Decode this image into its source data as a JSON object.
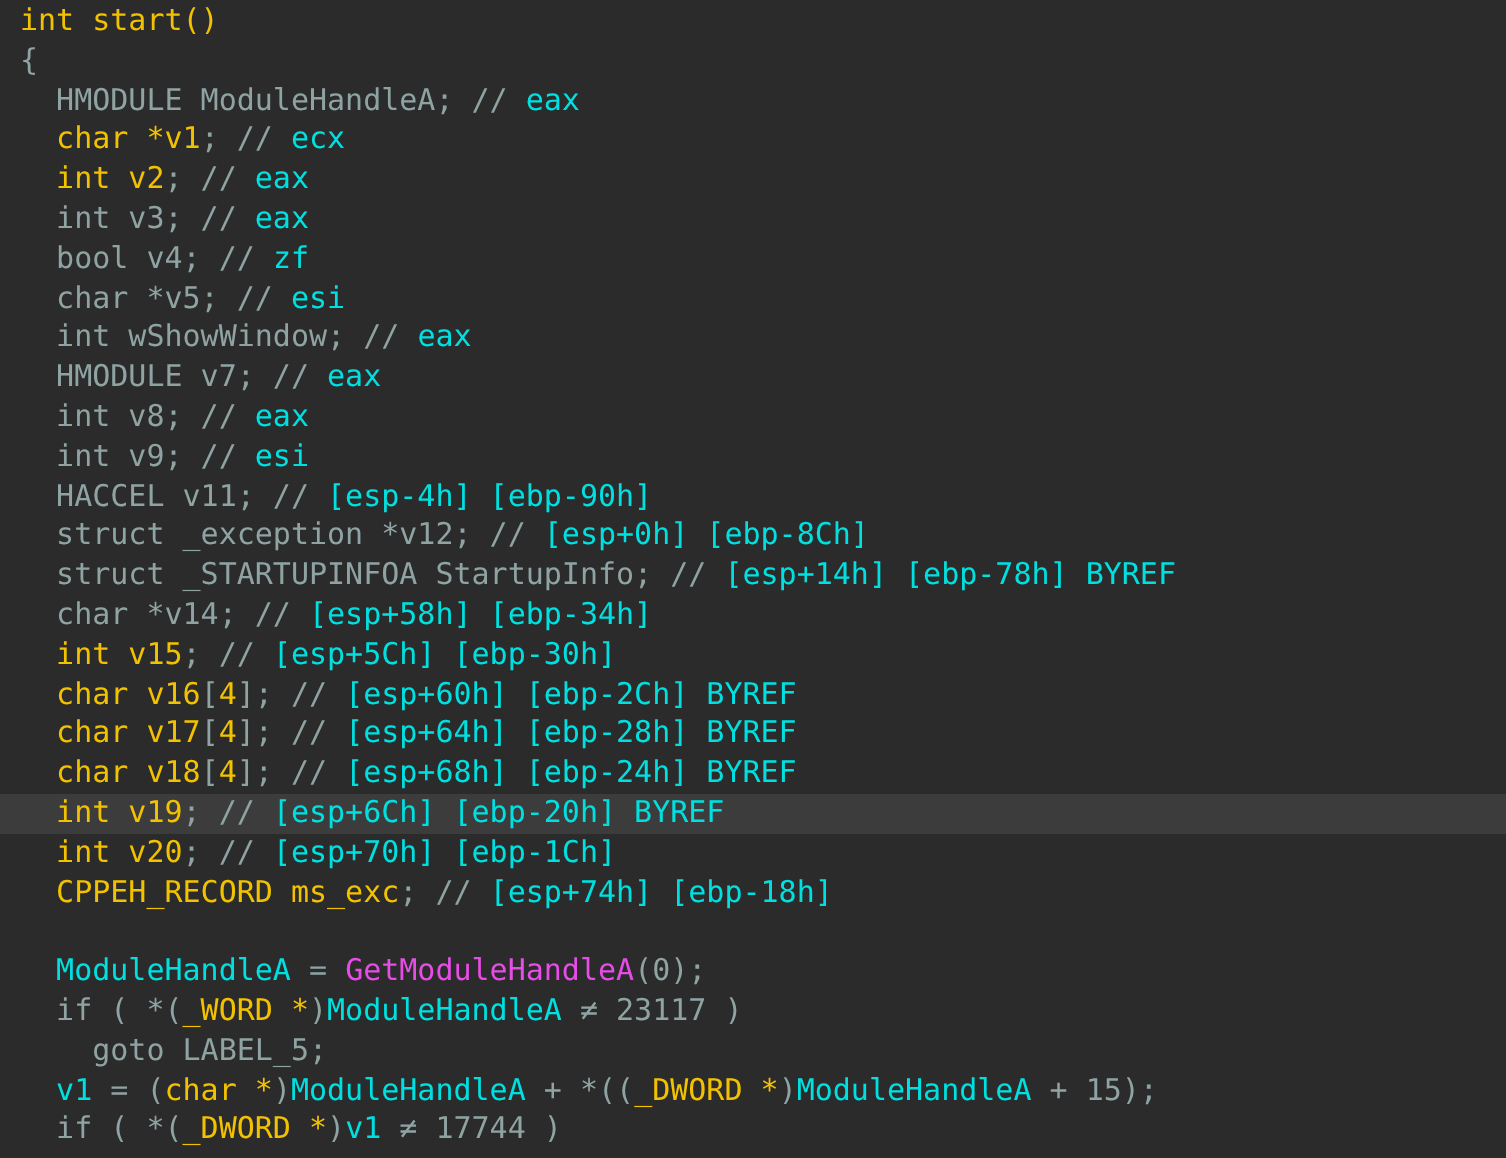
{
  "editor": {
    "lines": [
      {
        "current": false,
        "tokens": [
          {
            "kind": "var",
            "text": "int start()"
          }
        ]
      },
      {
        "current": false,
        "tokens": [
          {
            "kind": "plain",
            "text": "{"
          }
        ]
      },
      {
        "current": false,
        "tokens": [
          {
            "kind": "plain",
            "text": "  HMODULE ModuleHandleA; // "
          },
          {
            "kind": "ident",
            "text": "eax"
          }
        ]
      },
      {
        "current": false,
        "tokens": [
          {
            "kind": "var",
            "text": "  char *v1"
          },
          {
            "kind": "plain",
            "text": "; // "
          },
          {
            "kind": "ident",
            "text": "ecx"
          }
        ]
      },
      {
        "current": false,
        "tokens": [
          {
            "kind": "var",
            "text": "  int v2"
          },
          {
            "kind": "plain",
            "text": "; // "
          },
          {
            "kind": "ident",
            "text": "eax"
          }
        ]
      },
      {
        "current": false,
        "tokens": [
          {
            "kind": "plain",
            "text": "  int v3; // "
          },
          {
            "kind": "ident",
            "text": "eax"
          }
        ]
      },
      {
        "current": false,
        "tokens": [
          {
            "kind": "plain",
            "text": "  bool v4; // "
          },
          {
            "kind": "ident",
            "text": "zf"
          }
        ]
      },
      {
        "current": false,
        "tokens": [
          {
            "kind": "plain",
            "text": "  char *v5; // "
          },
          {
            "kind": "ident",
            "text": "esi"
          }
        ]
      },
      {
        "current": false,
        "tokens": [
          {
            "kind": "plain",
            "text": "  int wShowWindow; // "
          },
          {
            "kind": "ident",
            "text": "eax"
          }
        ]
      },
      {
        "current": false,
        "tokens": [
          {
            "kind": "plain",
            "text": "  HMODULE v7; // "
          },
          {
            "kind": "ident",
            "text": "eax"
          }
        ]
      },
      {
        "current": false,
        "tokens": [
          {
            "kind": "plain",
            "text": "  int v8; // "
          },
          {
            "kind": "ident",
            "text": "eax"
          }
        ]
      },
      {
        "current": false,
        "tokens": [
          {
            "kind": "plain",
            "text": "  int v9; // "
          },
          {
            "kind": "ident",
            "text": "esi"
          }
        ]
      },
      {
        "current": false,
        "tokens": [
          {
            "kind": "plain",
            "text": "  HACCEL v11; // "
          },
          {
            "kind": "ident",
            "text": "[esp-4h] [ebp-90h]"
          }
        ]
      },
      {
        "current": false,
        "tokens": [
          {
            "kind": "plain",
            "text": "  struct _exception *v12; // "
          },
          {
            "kind": "ident",
            "text": "[esp+0h] [ebp-8Ch]"
          }
        ]
      },
      {
        "current": false,
        "tokens": [
          {
            "kind": "plain",
            "text": "  struct _STARTUPINFOA StartupInfo; // "
          },
          {
            "kind": "ident",
            "text": "[esp+14h] [ebp-78h] BYREF"
          }
        ]
      },
      {
        "current": false,
        "tokens": [
          {
            "kind": "plain",
            "text": "  char *v14; // "
          },
          {
            "kind": "ident",
            "text": "[esp+58h] [ebp-34h]"
          }
        ]
      },
      {
        "current": false,
        "tokens": [
          {
            "kind": "var",
            "text": "  int v15"
          },
          {
            "kind": "plain",
            "text": "; // "
          },
          {
            "kind": "ident",
            "text": "[esp+5Ch] [ebp-30h]"
          }
        ]
      },
      {
        "current": false,
        "tokens": [
          {
            "kind": "var",
            "text": "  char v16"
          },
          {
            "kind": "plain",
            "text": "["
          },
          {
            "kind": "var",
            "text": "4"
          },
          {
            "kind": "plain",
            "text": "]; // "
          },
          {
            "kind": "ident",
            "text": "[esp+60h] [ebp-2Ch] BYREF"
          }
        ]
      },
      {
        "current": false,
        "tokens": [
          {
            "kind": "var",
            "text": "  char v17"
          },
          {
            "kind": "plain",
            "text": "["
          },
          {
            "kind": "var",
            "text": "4"
          },
          {
            "kind": "plain",
            "text": "]; // "
          },
          {
            "kind": "ident",
            "text": "[esp+64h] [ebp-28h] BYREF"
          }
        ]
      },
      {
        "current": false,
        "tokens": [
          {
            "kind": "var",
            "text": "  char v18"
          },
          {
            "kind": "plain",
            "text": "["
          },
          {
            "kind": "var",
            "text": "4"
          },
          {
            "kind": "plain",
            "text": "]; // "
          },
          {
            "kind": "ident",
            "text": "[esp+68h] [ebp-24h] BYREF"
          }
        ]
      },
      {
        "current": true,
        "tokens": [
          {
            "kind": "var",
            "text": "  int v19"
          },
          {
            "kind": "plain",
            "text": "; // "
          },
          {
            "kind": "ident",
            "text": "[esp+6Ch] [ebp-20h] BYREF"
          }
        ]
      },
      {
        "current": false,
        "tokens": [
          {
            "kind": "var",
            "text": "  int v20"
          },
          {
            "kind": "plain",
            "text": "; // "
          },
          {
            "kind": "ident",
            "text": "[esp+70h] [ebp-1Ch]"
          }
        ]
      },
      {
        "current": false,
        "tokens": [
          {
            "kind": "var",
            "text": "  CPPEH_RECORD ms_exc"
          },
          {
            "kind": "plain",
            "text": "; // "
          },
          {
            "kind": "ident",
            "text": "[esp+74h] [ebp-18h]"
          }
        ]
      },
      {
        "current": false
      },
      {
        "current": false,
        "tokens": [
          {
            "kind": "ident",
            "text": "  ModuleHandleA"
          },
          {
            "kind": "plain",
            "text": " = "
          },
          {
            "kind": "call",
            "text": "GetModuleHandleA"
          },
          {
            "kind": "plain",
            "text": "(0);"
          }
        ]
      },
      {
        "current": false,
        "tokens": [
          {
            "kind": "plain",
            "text": "  if ( *("
          },
          {
            "kind": "var",
            "text": "_WORD *"
          },
          {
            "kind": "plain",
            "text": ")"
          },
          {
            "kind": "ident",
            "text": "ModuleHandleA"
          },
          {
            "kind": "plain",
            "text": " ≠ 23117 )"
          }
        ]
      },
      {
        "current": false,
        "tokens": [
          {
            "kind": "plain",
            "text": "    goto LABEL_5;"
          }
        ]
      },
      {
        "current": false,
        "tokens": [
          {
            "kind": "ident",
            "text": "  v1"
          },
          {
            "kind": "plain",
            "text": " = ("
          },
          {
            "kind": "var",
            "text": "char *"
          },
          {
            "kind": "plain",
            "text": ")"
          },
          {
            "kind": "ident",
            "text": "ModuleHandleA"
          },
          {
            "kind": "plain",
            "text": " + *(("
          },
          {
            "kind": "var",
            "text": "_DWORD *"
          },
          {
            "kind": "plain",
            "text": ")"
          },
          {
            "kind": "ident",
            "text": "ModuleHandleA"
          },
          {
            "kind": "plain",
            "text": " + 15);"
          }
        ]
      },
      {
        "current": false,
        "tokens": [
          {
            "kind": "plain",
            "text": "  if ( *("
          },
          {
            "kind": "var",
            "text": "_DWORD *"
          },
          {
            "kind": "plain",
            "text": ")"
          },
          {
            "kind": "ident",
            "text": "v1"
          },
          {
            "kind": "plain",
            "text": " ≠ 17744 )"
          }
        ]
      }
    ]
  }
}
